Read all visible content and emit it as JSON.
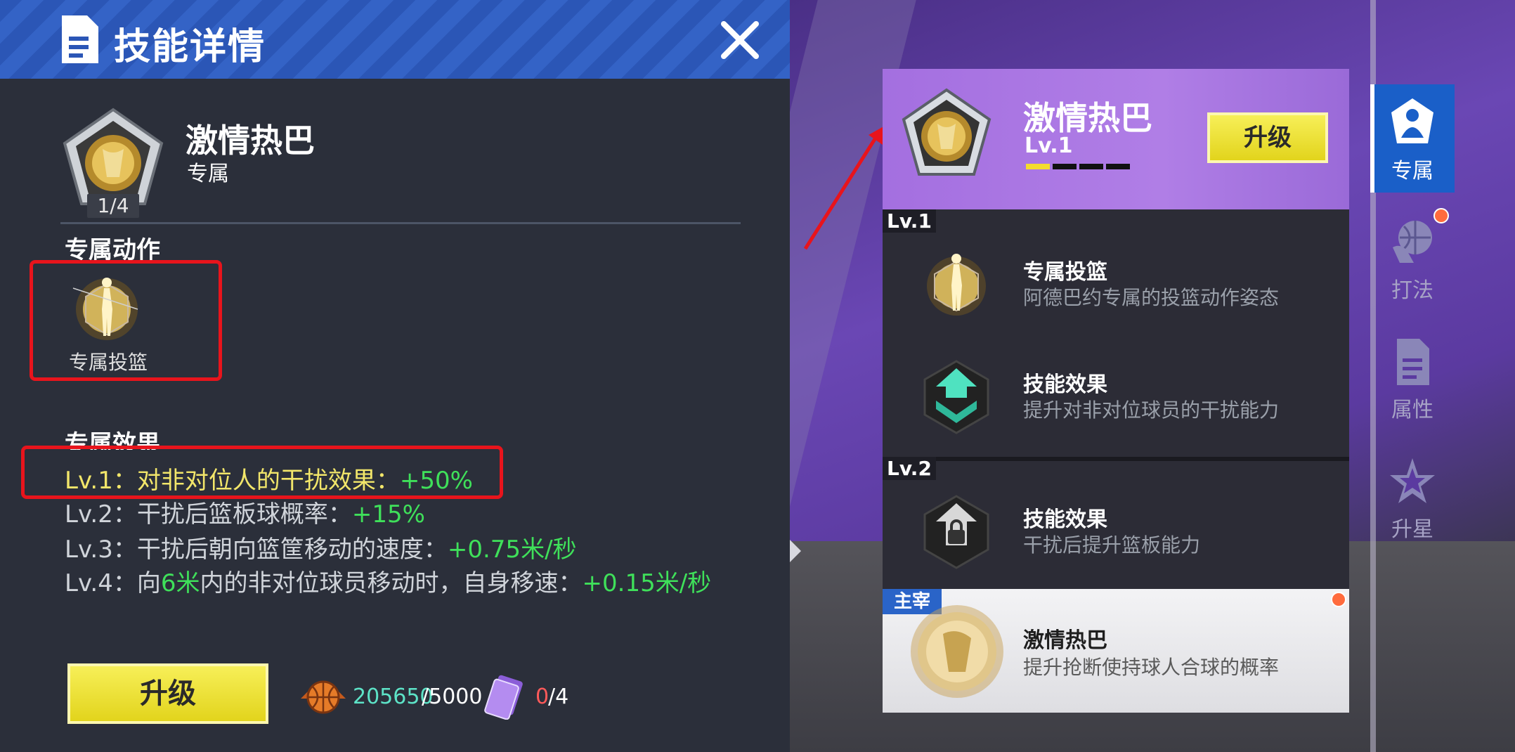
{
  "left": {
    "header_title": "技能详情",
    "skill_name": "激情热巴",
    "skill_type": "专属",
    "count": "1/4",
    "section_action": "专属动作",
    "action_label": "专属投篮",
    "section_effect": "专属效果",
    "effects": [
      {
        "prefix": "Lv.1：对非对位人的干扰效果：",
        "mid": "",
        "value": "+50%"
      },
      {
        "prefix": "Lv.2：干扰后篮板球概率：",
        "mid": "",
        "value": "+15%"
      },
      {
        "prefix": "Lv.3：干扰后朝向篮筐移动的速度：",
        "mid": "",
        "value": "+0.75米/秒"
      },
      {
        "prefix": "Lv.4：向",
        "mid_green": "6米",
        "mid_after": "内的非对位球员移动时，自身移速：",
        "value": "+0.15米/秒"
      }
    ],
    "upgrade_label": "升级",
    "coin_current": "205650",
    "coin_total": "/5000",
    "card_current": "0",
    "card_total": "/4"
  },
  "right": {
    "skill_name": "激情热巴",
    "level": "Lv.1",
    "level_progress": 0.25,
    "upgrade_label": "升级",
    "lv1_tag": "Lv.1",
    "lv2_tag": "Lv.2",
    "rows": [
      {
        "title": "专属投篮",
        "desc": "阿德巴约专属的投篮动作姿态"
      },
      {
        "title": "技能效果",
        "desc": "提升对非对位球员的干扰能力"
      },
      {
        "title": "技能效果",
        "desc": "干扰后提升篮板能力"
      }
    ],
    "dominate_tag": "主宰",
    "last_row": {
      "title": "激情热巴",
      "desc": "提升抢断使持球人合球的概率"
    }
  },
  "nav": [
    {
      "label": "专属",
      "icon": "player-icon",
      "active": true
    },
    {
      "label": "打法",
      "icon": "basketball-hand-icon",
      "active": false
    },
    {
      "label": "属性",
      "icon": "document-icon",
      "active": false
    },
    {
      "label": "升星",
      "icon": "star-icon",
      "active": false
    }
  ],
  "colors": {
    "accent_yellow": "#f4dc2e",
    "nav_active": "#1a5fc8",
    "highlight_red": "#e8141c",
    "value_green": "#3fe05a"
  }
}
